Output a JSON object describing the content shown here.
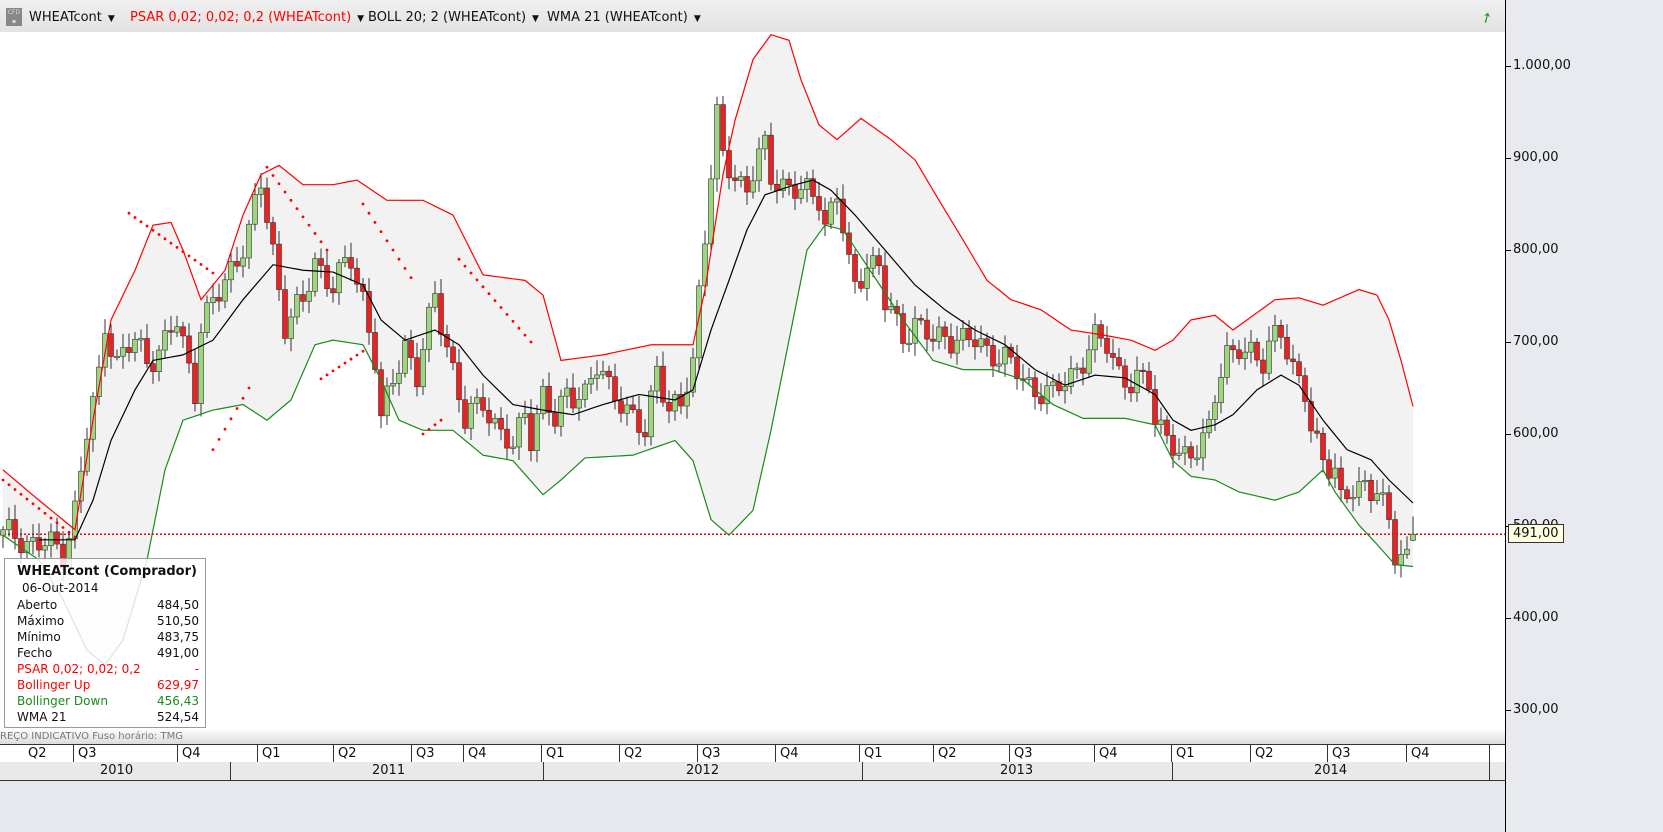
{
  "header": {
    "symbol": "WHEATcont",
    "psar": "PSAR 0,02; 0,02; 0,2 (WHEATcont)",
    "boll": "BOLL 20; 2 (WHEATcont)",
    "wma": "WMA 21 (WHEATcont)",
    "logo_text": "CFD",
    "colors": {
      "psar": "#ff0000",
      "text": "#111111"
    }
  },
  "info_box": {
    "title": "WHEATcont (Comprador)",
    "date": "06-Out-2014",
    "rows": [
      {
        "label": "Aberto",
        "value": "484,50",
        "color": "#111111"
      },
      {
        "label": "Máximo",
        "value": "510,50",
        "color": "#111111"
      },
      {
        "label": "Mínimo",
        "value": "483,75",
        "color": "#111111"
      },
      {
        "label": "Fecho",
        "value": "491,00",
        "color": "#111111"
      },
      {
        "label": "PSAR 0,02; 0,02; 0,2",
        "value": "-",
        "color": "#ff0000"
      },
      {
        "label": "Bollinger Up",
        "value": "629,97",
        "color": "#ff0000"
      },
      {
        "label": "Bollinger Down",
        "value": "456,43",
        "color": "#1a8a1a"
      },
      {
        "label": "WMA 21",
        "value": "524,54",
        "color": "#111111"
      }
    ]
  },
  "footnote": "REÇO INDICATIVO   Fuso horário: TMG",
  "current_price_label": "491,00",
  "chart_data": {
    "type": "candlestick",
    "title": "WHEATcont",
    "period": "weekly",
    "ylim": [
      260,
      1060
    ],
    "yticks": [
      {
        "value": 1000,
        "label": "1.000,00"
      },
      {
        "value": 900,
        "label": "900,00"
      },
      {
        "value": 800,
        "label": "800,00"
      },
      {
        "value": 700,
        "label": "700,00"
      },
      {
        "value": 600,
        "label": "600,00"
      },
      {
        "value": 500,
        "label": "500,00"
      },
      {
        "value": 400,
        "label": "400,00"
      },
      {
        "value": 300,
        "label": "300,00"
      }
    ],
    "current_price": 491.0,
    "last_candle": {
      "open": 484.5,
      "high": 510.5,
      "low": 483.75,
      "close": 491.0
    },
    "quarters": [
      "Q2",
      "Q3",
      "Q4",
      "Q1",
      "Q2",
      "Q3",
      "Q4",
      "Q1",
      "Q2",
      "Q3",
      "Q4",
      "Q1",
      "Q2",
      "Q3",
      "Q4",
      "Q1",
      "Q2",
      "Q3",
      "Q4"
    ],
    "years": [
      "2010",
      "2011",
      "2012",
      "2013",
      "2014"
    ],
    "close_anchors": [
      [
        0,
        490
      ],
      [
        7,
        480
      ],
      [
        10,
        470
      ],
      [
        12,
        520
      ],
      [
        14,
        600
      ],
      [
        16,
        660
      ],
      [
        17,
        720
      ],
      [
        19,
        680
      ],
      [
        22,
        700
      ],
      [
        24,
        680
      ],
      [
        27,
        700
      ],
      [
        29,
        720
      ],
      [
        32,
        650
      ],
      [
        33,
        720
      ],
      [
        36,
        750
      ],
      [
        38,
        780
      ],
      [
        41,
        820
      ],
      [
        43,
        870
      ],
      [
        45,
        800
      ],
      [
        47,
        720
      ],
      [
        50,
        740
      ],
      [
        52,
        790
      ],
      [
        55,
        760
      ],
      [
        58,
        790
      ],
      [
        60,
        750
      ],
      [
        62,
        680
      ],
      [
        63,
        610
      ],
      [
        65,
        660
      ],
      [
        67,
        700
      ],
      [
        69,
        660
      ],
      [
        71,
        720
      ],
      [
        72,
        750
      ],
      [
        74,
        700
      ],
      [
        76,
        640
      ],
      [
        77,
        610
      ],
      [
        80,
        640
      ],
      [
        82,
        610
      ],
      [
        85,
        580
      ],
      [
        87,
        630
      ],
      [
        88,
        600
      ],
      [
        90,
        640
      ],
      [
        92,
        610
      ],
      [
        94,
        650
      ],
      [
        97,
        640
      ],
      [
        99,
        670
      ],
      [
        102,
        650
      ],
      [
        104,
        620
      ],
      [
        107,
        600
      ],
      [
        109,
        680
      ],
      [
        111,
        620
      ],
      [
        113,
        630
      ],
      [
        115,
        680
      ],
      [
        116,
        760
      ],
      [
        117,
        820
      ],
      [
        119,
        940
      ],
      [
        120,
        900
      ],
      [
        122,
        880
      ],
      [
        124,
        870
      ],
      [
        127,
        910
      ],
      [
        128,
        880
      ],
      [
        131,
        870
      ],
      [
        133,
        860
      ],
      [
        136,
        860
      ],
      [
        137,
        830
      ],
      [
        139,
        860
      ],
      [
        141,
        780
      ],
      [
        142,
        760
      ],
      [
        144,
        790
      ],
      [
        146,
        780
      ],
      [
        147,
        740
      ],
      [
        150,
        710
      ],
      [
        152,
        720
      ],
      [
        155,
        700
      ],
      [
        157,
        710
      ],
      [
        160,
        700
      ],
      [
        162,
        700
      ],
      [
        165,
        690
      ],
      [
        167,
        680
      ],
      [
        170,
        660
      ],
      [
        172,
        650
      ],
      [
        175,
        640
      ],
      [
        177,
        660
      ],
      [
        180,
        680
      ],
      [
        182,
        700
      ],
      [
        184,
        700
      ],
      [
        186,
        670
      ],
      [
        188,
        650
      ],
      [
        191,
        660
      ],
      [
        192,
        620
      ],
      [
        194,
        600
      ],
      [
        196,
        570
      ],
      [
        197,
        570
      ],
      [
        199,
        590
      ],
      [
        201,
        610
      ],
      [
        202,
        640
      ],
      [
        204,
        680
      ],
      [
        206,
        700
      ],
      [
        208,
        690
      ],
      [
        210,
        670
      ],
      [
        212,
        710
      ],
      [
        213,
        720
      ],
      [
        215,
        670
      ],
      [
        217,
        640
      ],
      [
        218,
        600
      ],
      [
        220,
        580
      ],
      [
        222,
        560
      ],
      [
        223,
        525
      ],
      [
        224,
        530
      ],
      [
        226,
        540
      ],
      [
        227,
        550
      ],
      [
        229,
        540
      ],
      [
        231,
        500
      ],
      [
        232,
        465
      ],
      [
        234,
        470
      ],
      [
        235,
        491
      ]
    ],
    "bollinger_up": [
      [
        0,
        561
      ],
      [
        6,
        528
      ],
      [
        12,
        496
      ],
      [
        15,
        615
      ],
      [
        18,
        724
      ],
      [
        22,
        778
      ],
      [
        25,
        827
      ],
      [
        28,
        830
      ],
      [
        30,
        800
      ],
      [
        33,
        746
      ],
      [
        37,
        778
      ],
      [
        40,
        838
      ],
      [
        43,
        882
      ],
      [
        46,
        892
      ],
      [
        50,
        871
      ],
      [
        55,
        871
      ],
      [
        59,
        876
      ],
      [
        64,
        854
      ],
      [
        70,
        854
      ],
      [
        75,
        838
      ],
      [
        80,
        773
      ],
      [
        87,
        767
      ],
      [
        90,
        751
      ],
      [
        93,
        680
      ],
      [
        100,
        686
      ],
      [
        108,
        697
      ],
      [
        115,
        697
      ],
      [
        117,
        757
      ],
      [
        120,
        882
      ],
      [
        122,
        941
      ],
      [
        125,
        1007
      ],
      [
        128,
        1034
      ],
      [
        131,
        1028
      ],
      [
        133,
        985
      ],
      [
        136,
        936
      ],
      [
        139,
        920
      ],
      [
        143,
        943
      ],
      [
        148,
        920
      ],
      [
        152,
        898
      ],
      [
        156,
        854
      ],
      [
        160,
        811
      ],
      [
        164,
        767
      ],
      [
        168,
        746
      ],
      [
        173,
        735
      ],
      [
        178,
        713
      ],
      [
        183,
        708
      ],
      [
        188,
        702
      ],
      [
        192,
        691
      ],
      [
        195,
        702
      ],
      [
        198,
        724
      ],
      [
        202,
        729
      ],
      [
        205,
        713
      ],
      [
        212,
        746
      ],
      [
        216,
        748
      ],
      [
        220,
        740
      ],
      [
        226,
        757
      ],
      [
        229,
        751
      ],
      [
        231,
        724
      ],
      [
        233,
        680
      ],
      [
        235,
        630
      ]
    ],
    "bollinger_down": [
      [
        0,
        490
      ],
      [
        6,
        463
      ],
      [
        10,
        420
      ],
      [
        14,
        365
      ],
      [
        17,
        349
      ],
      [
        20,
        376
      ],
      [
        24,
        463
      ],
      [
        27,
        561
      ],
      [
        30,
        615
      ],
      [
        35,
        626
      ],
      [
        40,
        632
      ],
      [
        44,
        615
      ],
      [
        48,
        637
      ],
      [
        52,
        697
      ],
      [
        55,
        702
      ],
      [
        60,
        697
      ],
      [
        63,
        659
      ],
      [
        66,
        615
      ],
      [
        70,
        604
      ],
      [
        75,
        604
      ],
      [
        80,
        577
      ],
      [
        85,
        571
      ],
      [
        90,
        534
      ],
      [
        93,
        550
      ],
      [
        97,
        574
      ],
      [
        105,
        577
      ],
      [
        112,
        593
      ],
      [
        115,
        571
      ],
      [
        118,
        507
      ],
      [
        121,
        490
      ],
      [
        125,
        517
      ],
      [
        128,
        604
      ],
      [
        131,
        702
      ],
      [
        134,
        800
      ],
      [
        137,
        827
      ],
      [
        140,
        822
      ],
      [
        145,
        773
      ],
      [
        150,
        724
      ],
      [
        155,
        680
      ],
      [
        160,
        670
      ],
      [
        165,
        670
      ],
      [
        170,
        659
      ],
      [
        175,
        632
      ],
      [
        180,
        617
      ],
      [
        187,
        617
      ],
      [
        192,
        610
      ],
      [
        195,
        571
      ],
      [
        198,
        554
      ],
      [
        202,
        550
      ],
      [
        206,
        537
      ],
      [
        212,
        528
      ],
      [
        216,
        537
      ],
      [
        220,
        561
      ],
      [
        222,
        537
      ],
      [
        226,
        501
      ],
      [
        229,
        480
      ],
      [
        232,
        458
      ],
      [
        235,
        456
      ]
    ],
    "wma21": [
      [
        6,
        485
      ],
      [
        12,
        485
      ],
      [
        15,
        528
      ],
      [
        18,
        593
      ],
      [
        22,
        648
      ],
      [
        25,
        680
      ],
      [
        30,
        686
      ],
      [
        35,
        702
      ],
      [
        40,
        746
      ],
      [
        45,
        784
      ],
      [
        50,
        778
      ],
      [
        55,
        776
      ],
      [
        60,
        762
      ],
      [
        63,
        724
      ],
      [
        67,
        702
      ],
      [
        72,
        713
      ],
      [
        76,
        697
      ],
      [
        80,
        664
      ],
      [
        85,
        632
      ],
      [
        90,
        626
      ],
      [
        95,
        621
      ],
      [
        100,
        632
      ],
      [
        106,
        643
      ],
      [
        112,
        637
      ],
      [
        115,
        648
      ],
      [
        118,
        713
      ],
      [
        121,
        767
      ],
      [
        124,
        822
      ],
      [
        127,
        860
      ],
      [
        132,
        871
      ],
      [
        135,
        876
      ],
      [
        138,
        865
      ],
      [
        142,
        838
      ],
      [
        147,
        800
      ],
      [
        152,
        762
      ],
      [
        157,
        735
      ],
      [
        162,
        713
      ],
      [
        167,
        697
      ],
      [
        172,
        670
      ],
      [
        177,
        653
      ],
      [
        182,
        664
      ],
      [
        187,
        661
      ],
      [
        192,
        643
      ],
      [
        195,
        615
      ],
      [
        198,
        604
      ],
      [
        202,
        610
      ],
      [
        205,
        621
      ],
      [
        209,
        648
      ],
      [
        213,
        664
      ],
      [
        216,
        653
      ],
      [
        220,
        615
      ],
      [
        224,
        583
      ],
      [
        228,
        572
      ],
      [
        231,
        550
      ],
      [
        235,
        525
      ]
    ],
    "psar_segments": [
      [
        0,
        12,
        550,
        488
      ],
      [
        21,
        35,
        840,
        775
      ],
      [
        35,
        41,
        583,
        650
      ],
      [
        44,
        54,
        890,
        800
      ],
      [
        53,
        60,
        660,
        690
      ],
      [
        60,
        68,
        850,
        770
      ],
      [
        70,
        73,
        600,
        615
      ],
      [
        76,
        88,
        790,
        700
      ]
    ]
  }
}
